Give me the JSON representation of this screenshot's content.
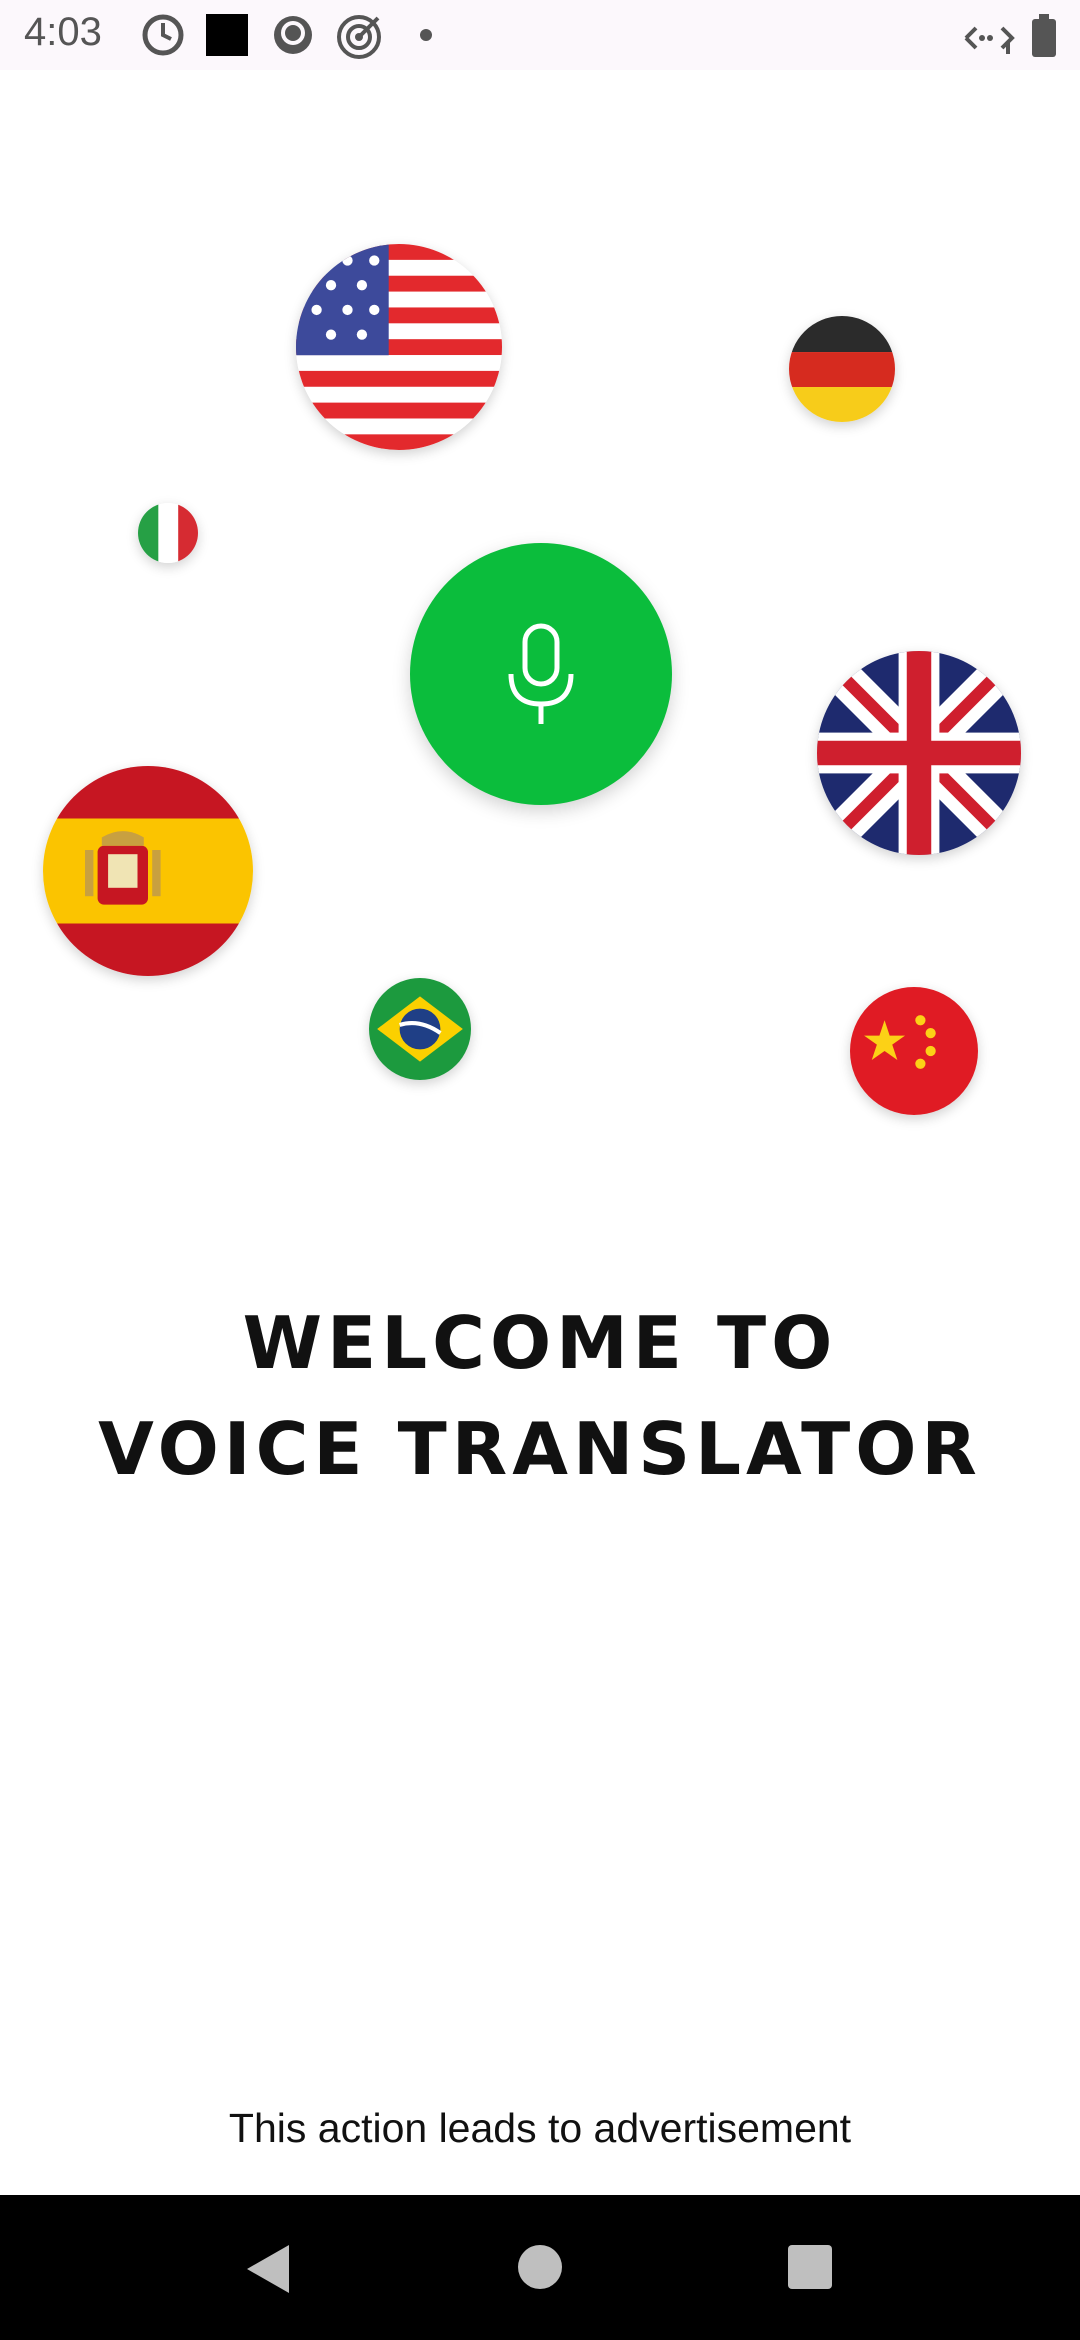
{
  "status_bar": {
    "time": "4:03",
    "left_icons": [
      "do-not-disturb-icon",
      "black-square-icon",
      "circle-camera-icon",
      "target-icon",
      "dot-icon"
    ],
    "right_icons": [
      "data-saver-icon",
      "battery-icon"
    ]
  },
  "flags": [
    {
      "name": "usa-flag-icon"
    },
    {
      "name": "germany-flag-icon"
    },
    {
      "name": "italy-flag-icon"
    },
    {
      "name": "uk-flag-icon"
    },
    {
      "name": "spain-flag-icon"
    },
    {
      "name": "brazil-flag-icon"
    },
    {
      "name": "china-flag-icon"
    }
  ],
  "mic": {
    "icon": "microphone-icon",
    "color": "#0bbd3c"
  },
  "welcome": {
    "line1": "WELCOME TO",
    "line2": "VOICE TRANSLATOR"
  },
  "ad_note": "This action leads to advertisement",
  "nav": {
    "back_icon": "back-triangle-icon",
    "home_icon": "home-circle-icon",
    "recents_icon": "recents-square-icon"
  }
}
